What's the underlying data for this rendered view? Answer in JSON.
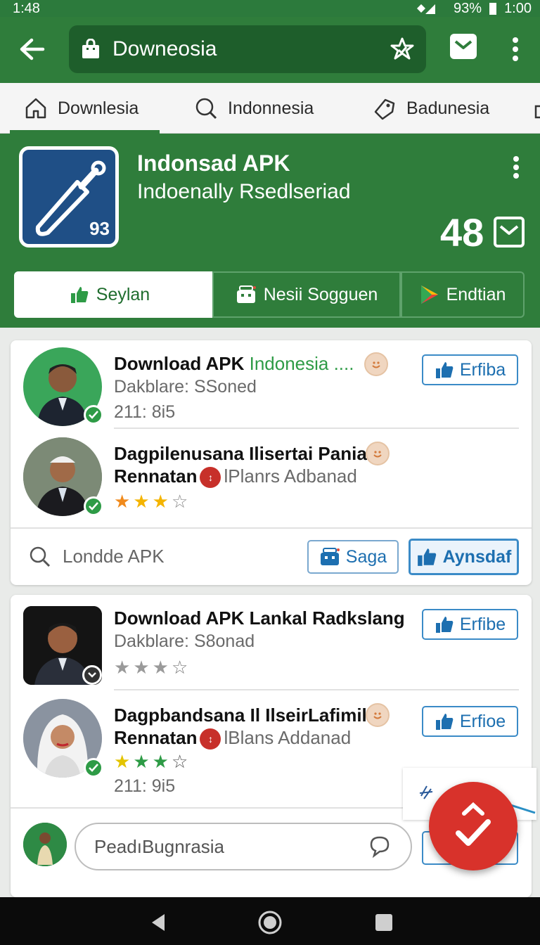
{
  "status_bar": {
    "time_left": "1:48",
    "battery": "93%",
    "time_right": "1:00"
  },
  "toolbar": {
    "url_text": "Downeosia"
  },
  "tabs": [
    {
      "label": "Downlesia",
      "icon": "home-icon"
    },
    {
      "label": "Indonnesia",
      "icon": "search-icon"
    },
    {
      "label": "Badunesia",
      "icon": "tag-icon"
    }
  ],
  "hero": {
    "app_title": "Indonsad APK",
    "app_subtitle": "Indoenally Rsedlseriad",
    "icon_number": "93",
    "count": "48"
  },
  "segments": [
    {
      "label": "Seylan",
      "icon": "thumbs-up-icon"
    },
    {
      "label": "Nesii Sogguen",
      "icon": "store-icon"
    },
    {
      "label": "Endtian",
      "icon": "play-store-icon"
    }
  ],
  "card1": {
    "item1": {
      "title_main": "Download APK ",
      "title_accent": "Indonesia ....",
      "subtitle": "Dakblare: SSoned",
      "meta": "211: 8i5",
      "button": "Erfiba"
    },
    "item2": {
      "title_line1": "Dagpilenusana Ilisertai Pania:",
      "title_line2": "Rennatan",
      "title_line2_rest": "lPlanrs Adbanad",
      "rating": 3
    },
    "search_placeholder": "Londde APK",
    "save_button": "Saga",
    "primary_button": "Aynsdaf"
  },
  "card2": {
    "item1": {
      "title": "Download APK Lankal Radkslang",
      "subtitle": "Dakblare: S8onad",
      "rating": 0,
      "button": "Erfibe"
    },
    "item2": {
      "title_line1": "Dagpbandsana Il IlseirLafimila:",
      "title_line2": "Rennatan",
      "title_line2_rest": "lBlans Addanad",
      "rating": 3,
      "meta": "211: 9i5",
      "button": "Erfioe"
    },
    "comment_placeholder": "PeadıBugnrasia"
  },
  "colors": {
    "primary_green": "#2f7d3b",
    "dark_green": "#1e5e2b",
    "accent_blue": "#1d6fb0",
    "fab_red": "#d8322b"
  }
}
